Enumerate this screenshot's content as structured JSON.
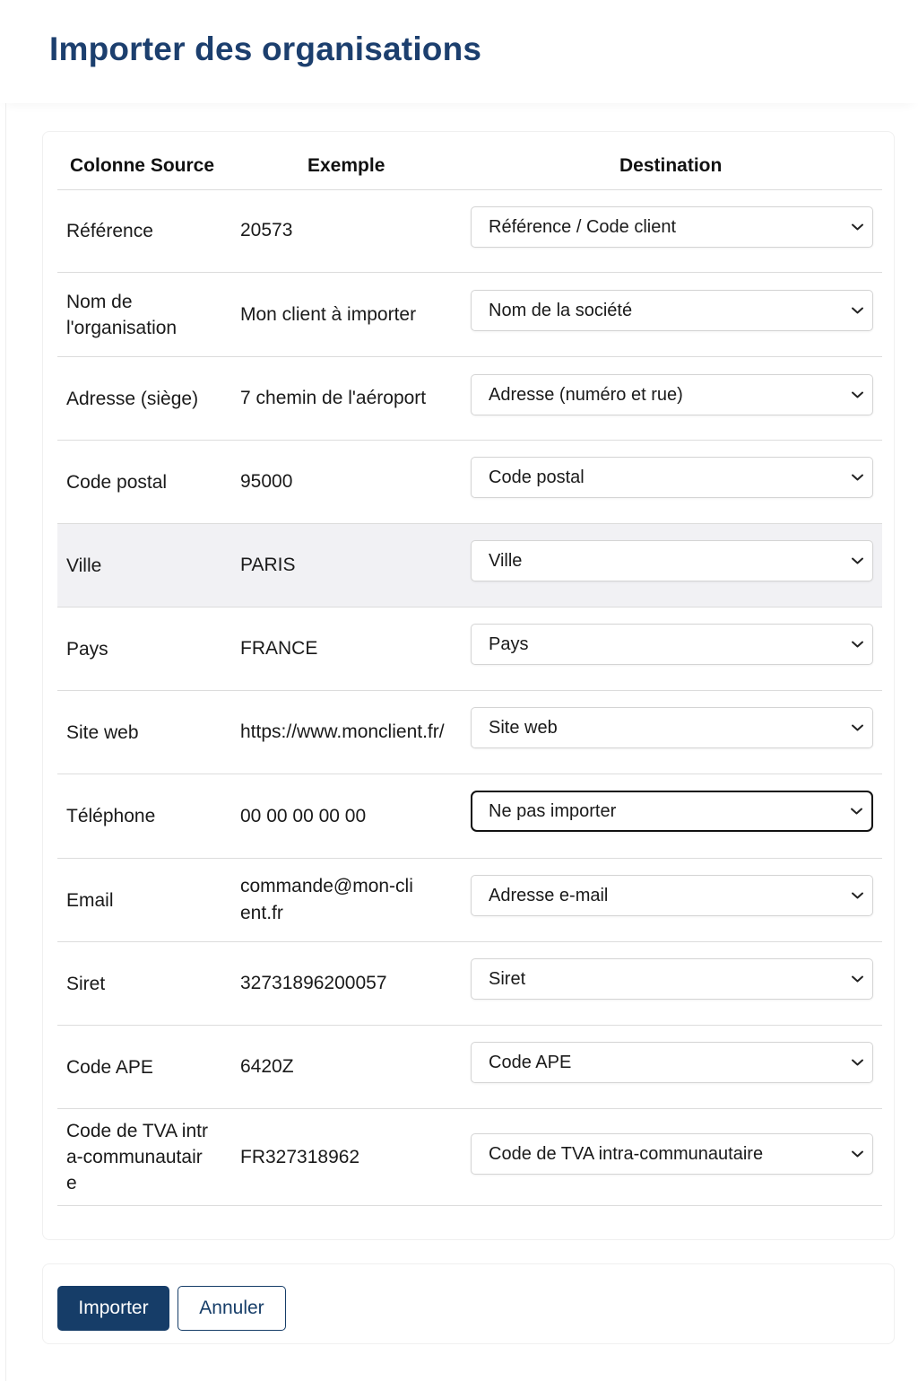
{
  "page": {
    "title": "Importer des organisations"
  },
  "table": {
    "headers": {
      "source": "Colonne Source",
      "example": "Exemple",
      "destination": "Destination"
    },
    "rows": [
      {
        "source": "Référence",
        "example": "20573",
        "destination": "Référence / Code client",
        "focused": false,
        "highlighted": false
      },
      {
        "source": "Nom de l'organisation",
        "example": "Mon client à importer",
        "destination": "Nom de la société",
        "focused": false,
        "highlighted": false
      },
      {
        "source": "Adresse (siège)",
        "example": "7 chemin de l'aéroport",
        "destination": "Adresse (numéro et rue)",
        "focused": false,
        "highlighted": false
      },
      {
        "source": "Code postal",
        "example": "95000",
        "destination": "Code postal",
        "focused": false,
        "highlighted": false
      },
      {
        "source": "Ville",
        "example": "PARIS",
        "destination": "Ville",
        "focused": false,
        "highlighted": true
      },
      {
        "source": "Pays",
        "example": "FRANCE",
        "destination": "Pays",
        "focused": false,
        "highlighted": false
      },
      {
        "source": "Site web",
        "example": "https://www.monclient.fr/",
        "destination": "Site web",
        "focused": false,
        "highlighted": false
      },
      {
        "source": "Téléphone",
        "example": "00 00 00 00 00",
        "destination": "Ne pas importer",
        "focused": true,
        "highlighted": false
      },
      {
        "source": "Email",
        "example": "commande@mon-client.fr",
        "destination": "Adresse e-mail",
        "focused": false,
        "highlighted": false
      },
      {
        "source": "Siret",
        "example": "32731896200057",
        "destination": "Siret",
        "focused": false,
        "highlighted": false
      },
      {
        "source": "Code APE",
        "example": "6420Z",
        "destination": "Code APE",
        "focused": false,
        "highlighted": false
      },
      {
        "source": "Code de TVA intra-communautaire",
        "example": "FR327318962",
        "destination": "Code de TVA intra-communautaire",
        "focused": false,
        "highlighted": false
      }
    ]
  },
  "actions": {
    "import_label": "Importer",
    "cancel_label": "Annuler"
  },
  "colors": {
    "brand": "#163d68",
    "title": "#1c3f6e",
    "row_highlight": "#f1f1f4",
    "focus_border": "#111111"
  },
  "icons": {
    "select_arrow": "chevron-down-icon"
  }
}
